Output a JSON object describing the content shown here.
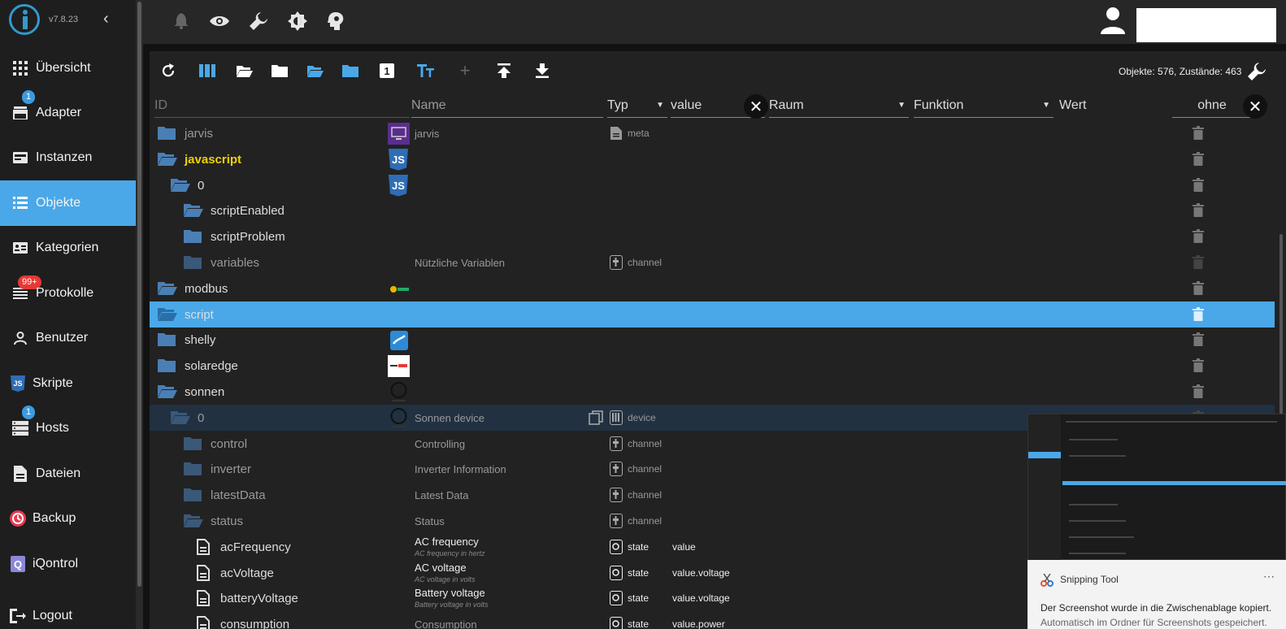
{
  "app": {
    "version": "v7.8.23"
  },
  "sidebar": {
    "items": [
      {
        "label": "Übersicht",
        "icon": "grid-icon"
      },
      {
        "label": "Adapter",
        "icon": "store-icon",
        "badge": "1"
      },
      {
        "label": "Instanzen",
        "icon": "instances-icon"
      },
      {
        "label": "Objekte",
        "icon": "list-icon",
        "active": true
      },
      {
        "label": "Kategorien",
        "icon": "categories-icon"
      },
      {
        "label": "Protokolle",
        "icon": "log-icon",
        "badge": "99+"
      },
      {
        "label": "Benutzer",
        "icon": "user-icon"
      },
      {
        "label": "Skripte",
        "icon": "js-icon"
      },
      {
        "label": "Hosts",
        "icon": "server-icon",
        "badge": "1"
      },
      {
        "label": "Dateien",
        "icon": "file-icon"
      },
      {
        "label": "Backup",
        "icon": "backup-icon"
      },
      {
        "label": "iQontrol",
        "icon": "iqontrol-icon"
      },
      {
        "label": "Logout",
        "icon": "logout-icon"
      }
    ]
  },
  "topbar": {
    "icons": [
      "bell-icon",
      "eye-icon",
      "wrench-icon",
      "brightness-icon",
      "expert-mode-icon"
    ]
  },
  "objects": {
    "stats": "Objekte: 576, Zustände: 463",
    "columns": {
      "id": "ID",
      "name": "Name",
      "type": "Typ",
      "value_filter": "value",
      "room": "Raum",
      "function": "Funktion",
      "value": "Wert",
      "value_filter2": "ohne"
    },
    "rows": [
      {
        "id": "jarvis",
        "name": "jarvis",
        "type": "meta"
      },
      {
        "id": "javascript"
      },
      {
        "id": "0"
      },
      {
        "id": "scriptEnabled"
      },
      {
        "id": "scriptProblem"
      },
      {
        "id": "variables",
        "name": "Nützliche Variablen",
        "type": "channel"
      },
      {
        "id": "modbus"
      },
      {
        "id": "script"
      },
      {
        "id": "shelly"
      },
      {
        "id": "solaredge"
      },
      {
        "id": "sonnen"
      },
      {
        "id": "0",
        "name": "Sonnen device",
        "type": "device"
      },
      {
        "id": "control",
        "name": "Controlling",
        "type": "channel"
      },
      {
        "id": "inverter",
        "name": "Inverter Information",
        "type": "channel"
      },
      {
        "id": "latestData",
        "name": "Latest Data",
        "type": "channel"
      },
      {
        "id": "status",
        "name": "Status",
        "type": "channel"
      },
      {
        "id": "acFrequency",
        "name": "AC frequency",
        "desc": "AC frequency in hertz",
        "type": "state",
        "role": "value"
      },
      {
        "id": "acVoltage",
        "name": "AC voltage",
        "desc": "AC voltage in volts",
        "type": "state",
        "role": "value.voltage"
      },
      {
        "id": "batteryVoltage",
        "name": "Battery voltage",
        "desc": "Battery voltage in volts",
        "type": "state",
        "role": "value.voltage"
      },
      {
        "id": "consumption",
        "name": "Consumption",
        "type": "state",
        "role": "value.power"
      }
    ]
  },
  "snipping": {
    "title": "Snipping Tool",
    "message": "Der Screenshot wurde in die Zwischenablage kopiert.",
    "message2": "Automatisch im Ordner für Screenshots gespeichert."
  }
}
